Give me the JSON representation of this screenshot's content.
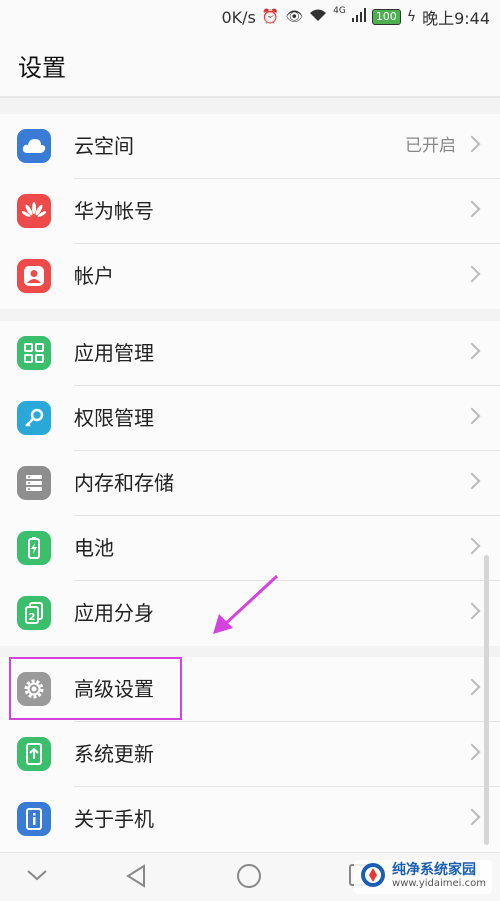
{
  "status_bar": {
    "speed": "0K/s",
    "network": "4G",
    "battery": "100",
    "time": "晚上9:44"
  },
  "header": {
    "title": "设置"
  },
  "groups": [
    {
      "items": [
        {
          "label": "云空间",
          "value": "已开启",
          "icon": "cloud-icon",
          "color": "#3a7bd5"
        },
        {
          "label": "华为帐号",
          "value": "",
          "icon": "huawei-logo-icon",
          "color": "#ef4a4a"
        },
        {
          "label": "帐户",
          "value": "",
          "icon": "user-icon",
          "color": "#ef4a4a"
        }
      ]
    },
    {
      "items": [
        {
          "label": "应用管理",
          "value": "",
          "icon": "apps-grid-icon",
          "color": "#3cbf6d"
        },
        {
          "label": "权限管理",
          "value": "",
          "icon": "key-icon",
          "color": "#2aa8d8"
        },
        {
          "label": "内存和存储",
          "value": "",
          "icon": "storage-icon",
          "color": "#8e8e8e"
        },
        {
          "label": "电池",
          "value": "",
          "icon": "battery-icon",
          "color": "#3cbf6d"
        },
        {
          "label": "应用分身",
          "value": "",
          "icon": "app-twin-icon",
          "color": "#3cbf6d"
        }
      ]
    },
    {
      "items": [
        {
          "label": "高级设置",
          "value": "",
          "icon": "gear-icon",
          "color": "#9a9a9a"
        },
        {
          "label": "系统更新",
          "value": "",
          "icon": "system-update-icon",
          "color": "#3cbf6d"
        },
        {
          "label": "关于手机",
          "value": "",
          "icon": "info-icon",
          "color": "#3a7bd5"
        }
      ]
    }
  ],
  "watermark": {
    "title": "纯净系统家园",
    "url": "www.yidaimei.com"
  }
}
